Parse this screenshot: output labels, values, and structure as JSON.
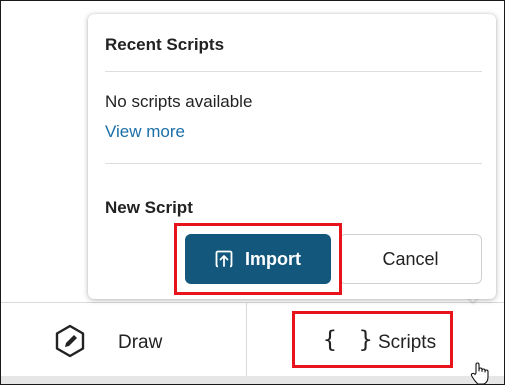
{
  "popover": {
    "recent_title": "Recent Scripts",
    "empty_text": "No scripts available",
    "view_more": "View more",
    "new_title": "New Script",
    "import_label": "Import",
    "cancel_label": "Cancel"
  },
  "toolbar": {
    "draw_label": "Draw",
    "scripts_icon": "{ }",
    "scripts_label": "Scripts"
  },
  "icons": {
    "draw": "pencil-hexagon-icon",
    "scripts": "curly-braces-icon",
    "import": "upload-icon",
    "cursor": "hand-pointer-icon"
  },
  "colors": {
    "primary": "#13587c",
    "link": "#1b6fa8",
    "highlight": "#e8141b"
  }
}
